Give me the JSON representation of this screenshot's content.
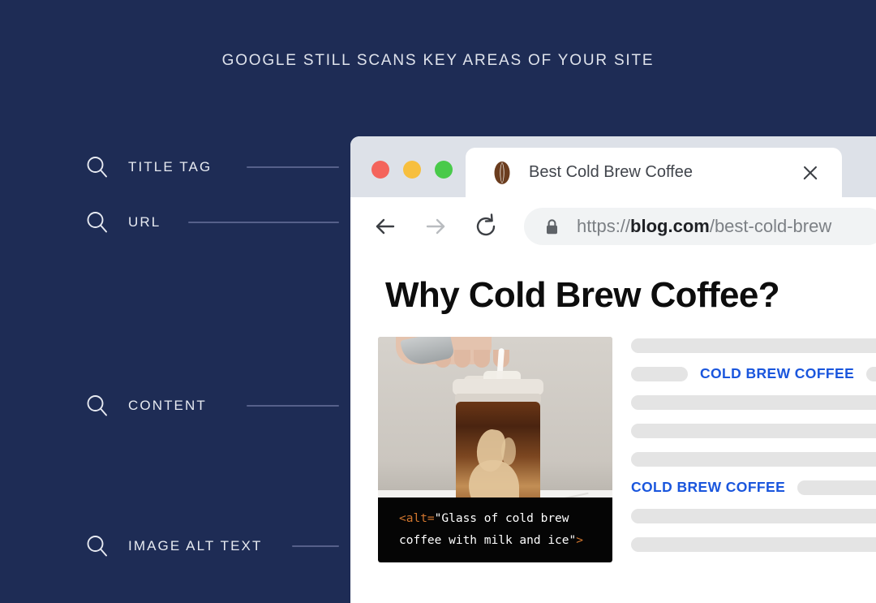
{
  "headline": "GOOGLE STILL SCANS KEY AREAS OF YOUR SITE",
  "theme": {
    "background": "#1e2c55",
    "accent_blue": "#1a56dd",
    "line_color": "#56608a",
    "code_orange": "#d2762e"
  },
  "checklist": {
    "items": [
      {
        "label": "TITLE TAG",
        "icon": "search-icon"
      },
      {
        "label": "URL",
        "icon": "search-icon"
      },
      {
        "label": "CONTENT",
        "icon": "search-icon"
      },
      {
        "label": "IMAGE ALT TEXT",
        "icon": "search-icon"
      }
    ]
  },
  "browser": {
    "window_controls": [
      {
        "name": "close",
        "color": "#f4645c"
      },
      {
        "name": "minimize",
        "color": "#f7bf3e"
      },
      {
        "name": "maximize",
        "color": "#49ca4a"
      }
    ],
    "tab": {
      "favicon": "coffee-bean-icon",
      "title": "Best Cold Brew Coffee",
      "close_label": "×"
    },
    "toolbar": {
      "back_icon": "arrow-left-icon",
      "forward_icon": "arrow-right-icon",
      "reload_icon": "reload-icon",
      "lock_icon": "lock-icon",
      "url_scheme": "https://",
      "url_host": "blog.com",
      "url_path": "/best-cold-brew"
    },
    "page": {
      "title": "Why Cold Brew Coffee?",
      "image": {
        "alt_overlay": {
          "open_tag": "<alt=",
          "text_line_1": "\"Glass of cold brew",
          "text_line_2": "coffee with milk and ice\"",
          "close_tag": ">"
        }
      },
      "body_rows": [
        {
          "type": "bar"
        },
        {
          "type": "link-row",
          "lead_bar": true,
          "link": "COLD BREW COFFEE",
          "trail_bar": true
        },
        {
          "type": "bar"
        },
        {
          "type": "bar"
        },
        {
          "type": "bar"
        },
        {
          "type": "link-row",
          "lead_bar": false,
          "link": "COLD BREW COFFEE",
          "trail_bar": true
        },
        {
          "type": "bar"
        },
        {
          "type": "bar"
        }
      ]
    }
  }
}
